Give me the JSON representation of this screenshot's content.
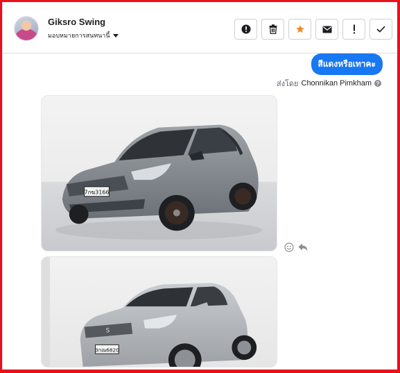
{
  "conversation": {
    "contact_name": "Giksro Swing",
    "assign_label": "มอบหมายการสนทนานี้",
    "actions": [
      {
        "name": "report-spam-button",
        "icon": "exclamation-circle-icon"
      },
      {
        "name": "delete-button",
        "icon": "trash-icon"
      },
      {
        "name": "star-button",
        "icon": "star-icon",
        "color": "#f0892e"
      },
      {
        "name": "mark-unread-button",
        "icon": "envelope-icon"
      },
      {
        "name": "mark-important-button",
        "icon": "exclamation-icon"
      },
      {
        "name": "mark-done-button",
        "icon": "check-icon"
      }
    ]
  },
  "messages": {
    "outgoing_text": "สีแดงหรือเทาคะ",
    "sent_by_prefix": "ส่งโดย",
    "sent_by_name": "Chonnikan Pimkham",
    "bubble_color": "#1877f2",
    "plate_1": "7กฆ3166",
    "plate_2": "3กณ6820"
  }
}
